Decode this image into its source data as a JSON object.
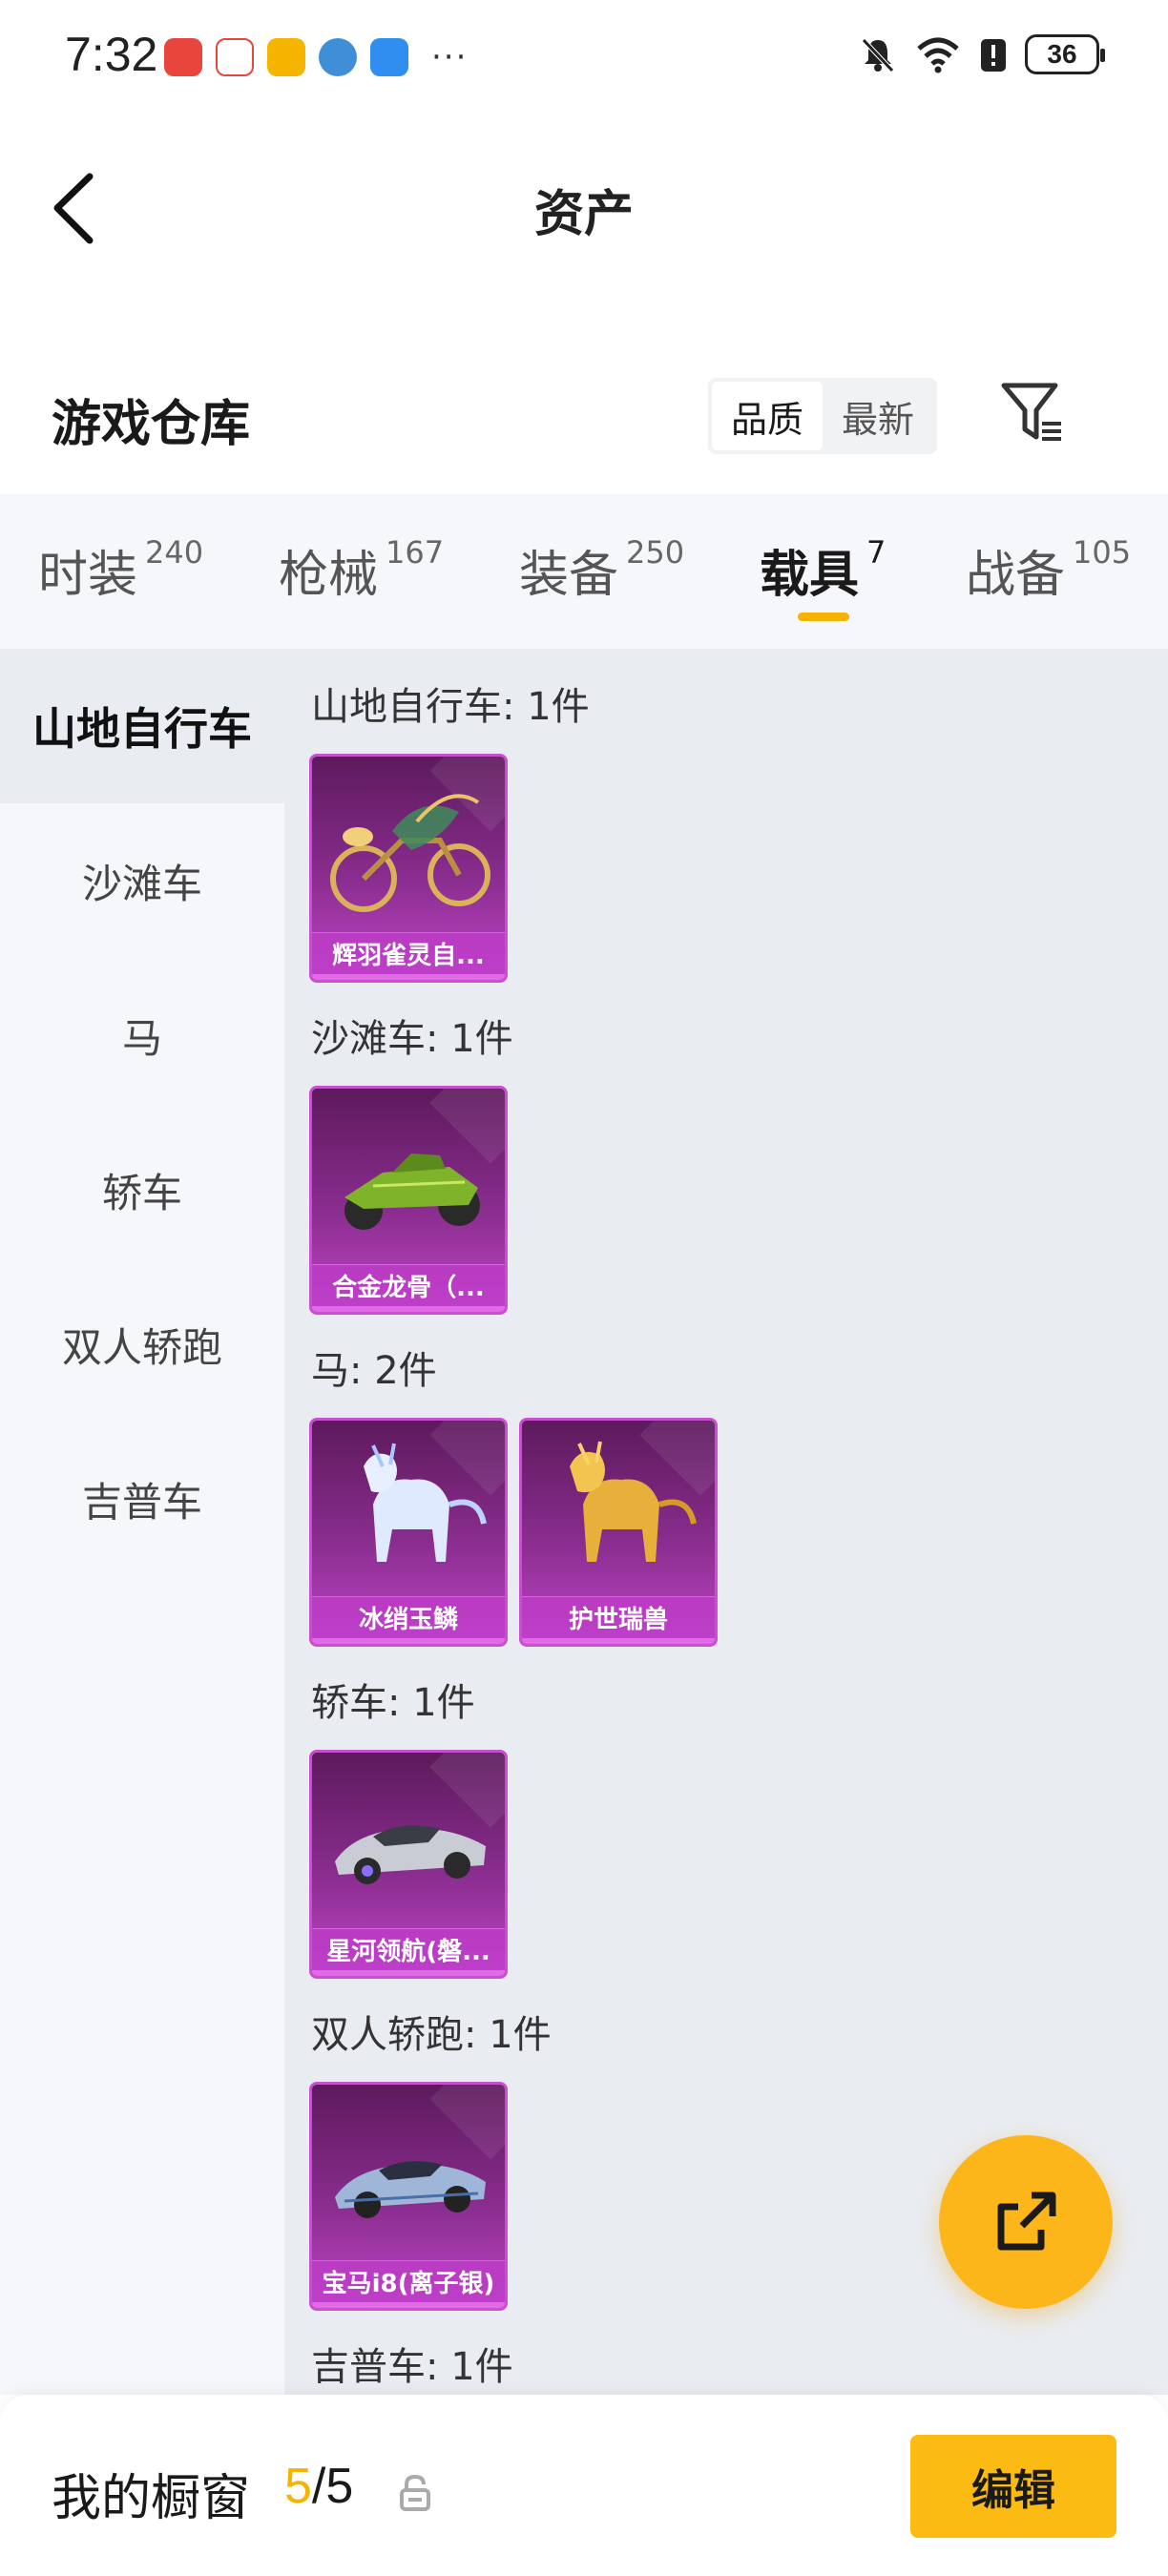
{
  "status_bar": {
    "time": "7:32",
    "battery": "36",
    "icons": [
      "huawei-app-icon",
      "news-app-icon",
      "chat-app-icon",
      "browser-app-icon",
      "weather-app-icon",
      "more-dots-icon",
      "mute-bell-icon",
      "wifi-icon",
      "alert-icon",
      "battery-icon"
    ],
    "more": "···"
  },
  "header": {
    "title": "资产",
    "back_icon": "back-arrow-icon"
  },
  "warehouse": {
    "title": "游戏仓库",
    "sort_options": [
      "品质",
      "最新"
    ],
    "active_sort": "品质",
    "filter_icon": "filter-icon"
  },
  "tabs": [
    {
      "label": "时装",
      "count": "240"
    },
    {
      "label": "枪械",
      "count": "167"
    },
    {
      "label": "装备",
      "count": "250"
    },
    {
      "label": "载具",
      "count": "7",
      "active": true
    },
    {
      "label": "战备",
      "count": "105"
    }
  ],
  "sidebar": {
    "items": [
      "山地自行车",
      "沙滩车",
      "马",
      "轿车",
      "双人轿跑",
      "吉普车"
    ],
    "active": "山地自行车"
  },
  "groups": [
    {
      "title": "山地自行车: 1件",
      "items": [
        {
          "name": "辉羽雀灵自...",
          "icon": "golden-bicycle-icon"
        }
      ]
    },
    {
      "title": "沙滩车: 1件",
      "items": [
        {
          "name": "合金龙骨（...",
          "icon": "green-buggy-icon"
        }
      ]
    },
    {
      "title": "马: 2件",
      "items": [
        {
          "name": "冰绡玉鳞",
          "icon": "ice-qilin-icon"
        },
        {
          "name": "护世瑞兽",
          "icon": "golden-qilin-icon"
        }
      ]
    },
    {
      "title": "轿车: 1件",
      "items": [
        {
          "name": "星河领航(磐...",
          "icon": "silver-sedan-icon"
        }
      ]
    },
    {
      "title": "双人轿跑: 1件",
      "items": [
        {
          "name": "宝马i8(离子银)",
          "icon": "blue-coupe-icon"
        }
      ]
    },
    {
      "title": "吉普车: 1件",
      "items": []
    }
  ],
  "fab": {
    "icon": "share-external-icon"
  },
  "bottom_bar": {
    "label": "我的橱窗",
    "current": "5",
    "separator": "/",
    "total": "5",
    "lock_icon": "lock-open-icon",
    "edit_label": "编辑"
  },
  "colors": {
    "accent": "#f5b400",
    "card_purple": "#8a2d8f",
    "fab": "#fdb61a"
  }
}
